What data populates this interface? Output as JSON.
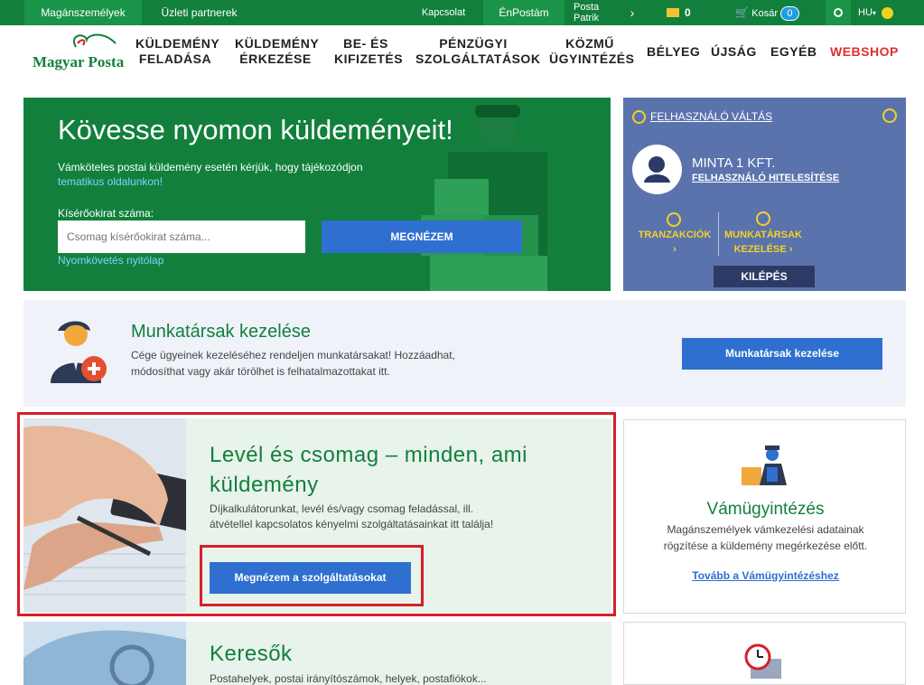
{
  "topbar": {
    "private": "Magánszemélyek",
    "business": "Üzleti partnerek",
    "contact": "Kapcsolat",
    "enpostam": "ÉnPostám",
    "user_line1": "Posta",
    "user_line2": "Patrik",
    "mail_count": "0",
    "cart_label": "Kosár",
    "cart_count": "0",
    "lang": "HU",
    "colors": {
      "bar": "#12803c",
      "accent": "#1a9448"
    }
  },
  "nav": {
    "logo_text": "Magyar Posta",
    "items": [
      "KÜLDEMÉNY\nFELADÁSA",
      "KÜLDEMÉNY\nÉRKEZÉSE",
      "BE- ÉS\nKIFIZETÉS",
      "PÉNZÜGYI\nSZOLGÁLTATÁSOK",
      "KÖZMŰ\nÜGYINTÉZÉS",
      "BÉLYEG",
      "ÚJSÁG",
      "EGYÉB",
      "WEBSHOP"
    ]
  },
  "hero": {
    "title": "Kövesse nyomon küldeményeit!",
    "text": "Vámköteles postai küldemény esetén kérjük, hogy tájékozódjon",
    "text_link": "tematikus oldalunkon!",
    "input_label": "Kísérőokirat száma:",
    "input_placeholder": "Csomag kísérőokirat száma...",
    "button": "MEGNÉZEM",
    "home_link": "Nyomkövetés nyitólap"
  },
  "account": {
    "switch_user": "FELHASZNÁLÓ VÁLTÁS",
    "company": "MINTA 1 KFT.",
    "authenticate": "FELHASZNÁLÓ HITELESÍTÉSE",
    "transactions": "TRANZAKCIÓK ›",
    "colleagues": "MUNKATÁRSAK\nKEZELÉSE ›",
    "logout": "KILÉPÉS"
  },
  "colleagues": {
    "title": "Munkatársak kezelése",
    "desc": "Cége ügyeinek kezeléséhez rendeljen munkatársakat! Hozzáadhat, módosíthat vagy akár törölhet is felhatalmazottakat itt.",
    "button": "Munkatársak kezelése"
  },
  "letters": {
    "title": "Levél és csomag – minden, ami küldemény",
    "desc": "Díjkalkulátorunkat, levél és/vagy csomag feladással, ill. átvétellel kapcsolatos kényelmi szolgáltatásainkat itt találja!",
    "button": "Megnézem a szolgáltatásokat"
  },
  "customs": {
    "title": "Vámügyintézés",
    "desc": "Magánszemélyek vámkezelési adatainak rögzítése a küldemény megérkezése előtt.",
    "link": "Tovább a Vámügyintézéshez"
  },
  "search": {
    "title": "Keresők",
    "desc": "Postahelyek, postai irányítószámok, helyek, postafiókok..."
  }
}
